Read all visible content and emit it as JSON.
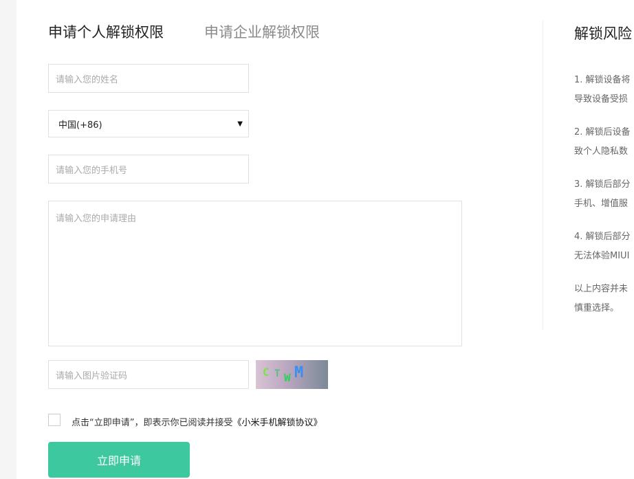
{
  "tabs": {
    "personal": "申请个人解锁权限",
    "enterprise": "申请企业解锁权限"
  },
  "form": {
    "name_placeholder": "请输入您的姓名",
    "country_value": "中国(+86)",
    "phone_placeholder": "请输入您的手机号",
    "reason_placeholder": "请输入您的申请理由",
    "captcha_placeholder": "请输入图片验证码",
    "captcha_chars": [
      "C",
      "T",
      "W",
      "M"
    ],
    "agree_prefix": "点击“立即申请”，即表示你已阅读并接受",
    "agree_link": "《小米手机解锁协议》",
    "submit_label": "立即申请"
  },
  "risk": {
    "title": "解锁风险",
    "lines": [
      "1. 解锁设备将",
      "导致设备受损",
      "2. 解锁后设备",
      "致个人隐私数",
      "3. 解锁后部分",
      "手机、增值服",
      "4. 解锁后部分",
      "无法体验MIUI",
      "以上内容并未",
      "慎重选择。"
    ]
  }
}
